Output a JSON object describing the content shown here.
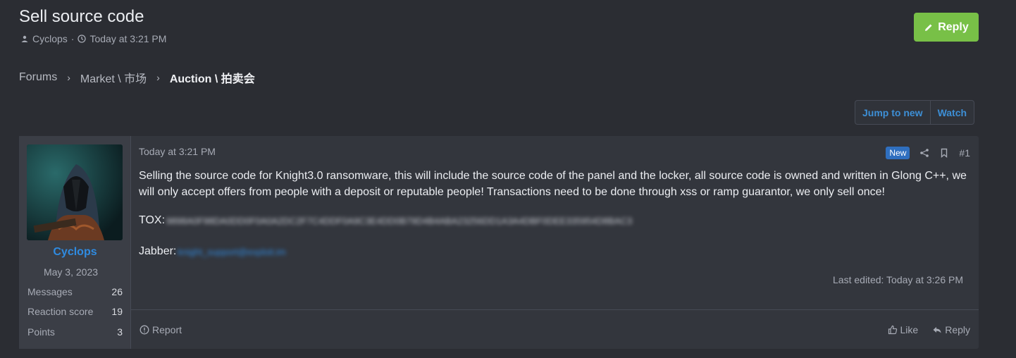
{
  "thread": {
    "title": "Sell source code",
    "author": "Cyclops",
    "separator": "·",
    "date": "Today at 3:21 PM",
    "reply_label": "Reply"
  },
  "breadcrumb": {
    "items": [
      "Forums",
      "Market \\ 市场"
    ],
    "current": "Auction \\ 拍卖会",
    "separator": "›"
  },
  "thread_buttons": {
    "jump_to_new": "Jump to new",
    "watch": "Watch"
  },
  "post": {
    "user": {
      "name": "Cyclops",
      "joined": "May 3, 2023",
      "stats": [
        {
          "label": "Messages",
          "value": "26"
        },
        {
          "label": "Reaction score",
          "value": "19"
        },
        {
          "label": "Points",
          "value": "3"
        }
      ]
    },
    "date": "Today at 3:21 PM",
    "badge": "New",
    "number": "#1",
    "body": "Selling the source code for Knight3.0 ransomware, this will include the source code of the panel and the locker, all source code is owned and written in Glong C++, we will only accept offers from people with a deposit or reputable people! Transactions need to be done through xss or ramp guarantor, we only sell once!",
    "tox_label": "TOX:",
    "tox_value": "9898A0F98DA0DD0F0A0A2DC2F7C4DDF0A9C3E4DD0B79D4B4ABA23256DD1A3A4DBF0DEE335954D8BAC3",
    "jabber_label": "Jabber:",
    "jabber_value": "knight_support@exploit.im",
    "edited": "Last edited: Today at 3:26 PM",
    "report_label": "Report",
    "like_label": "Like",
    "reply_label": "Reply"
  },
  "colors": {
    "background": "#2b2d33",
    "accent_green": "#78c047",
    "link_blue": "#2f8be1"
  }
}
